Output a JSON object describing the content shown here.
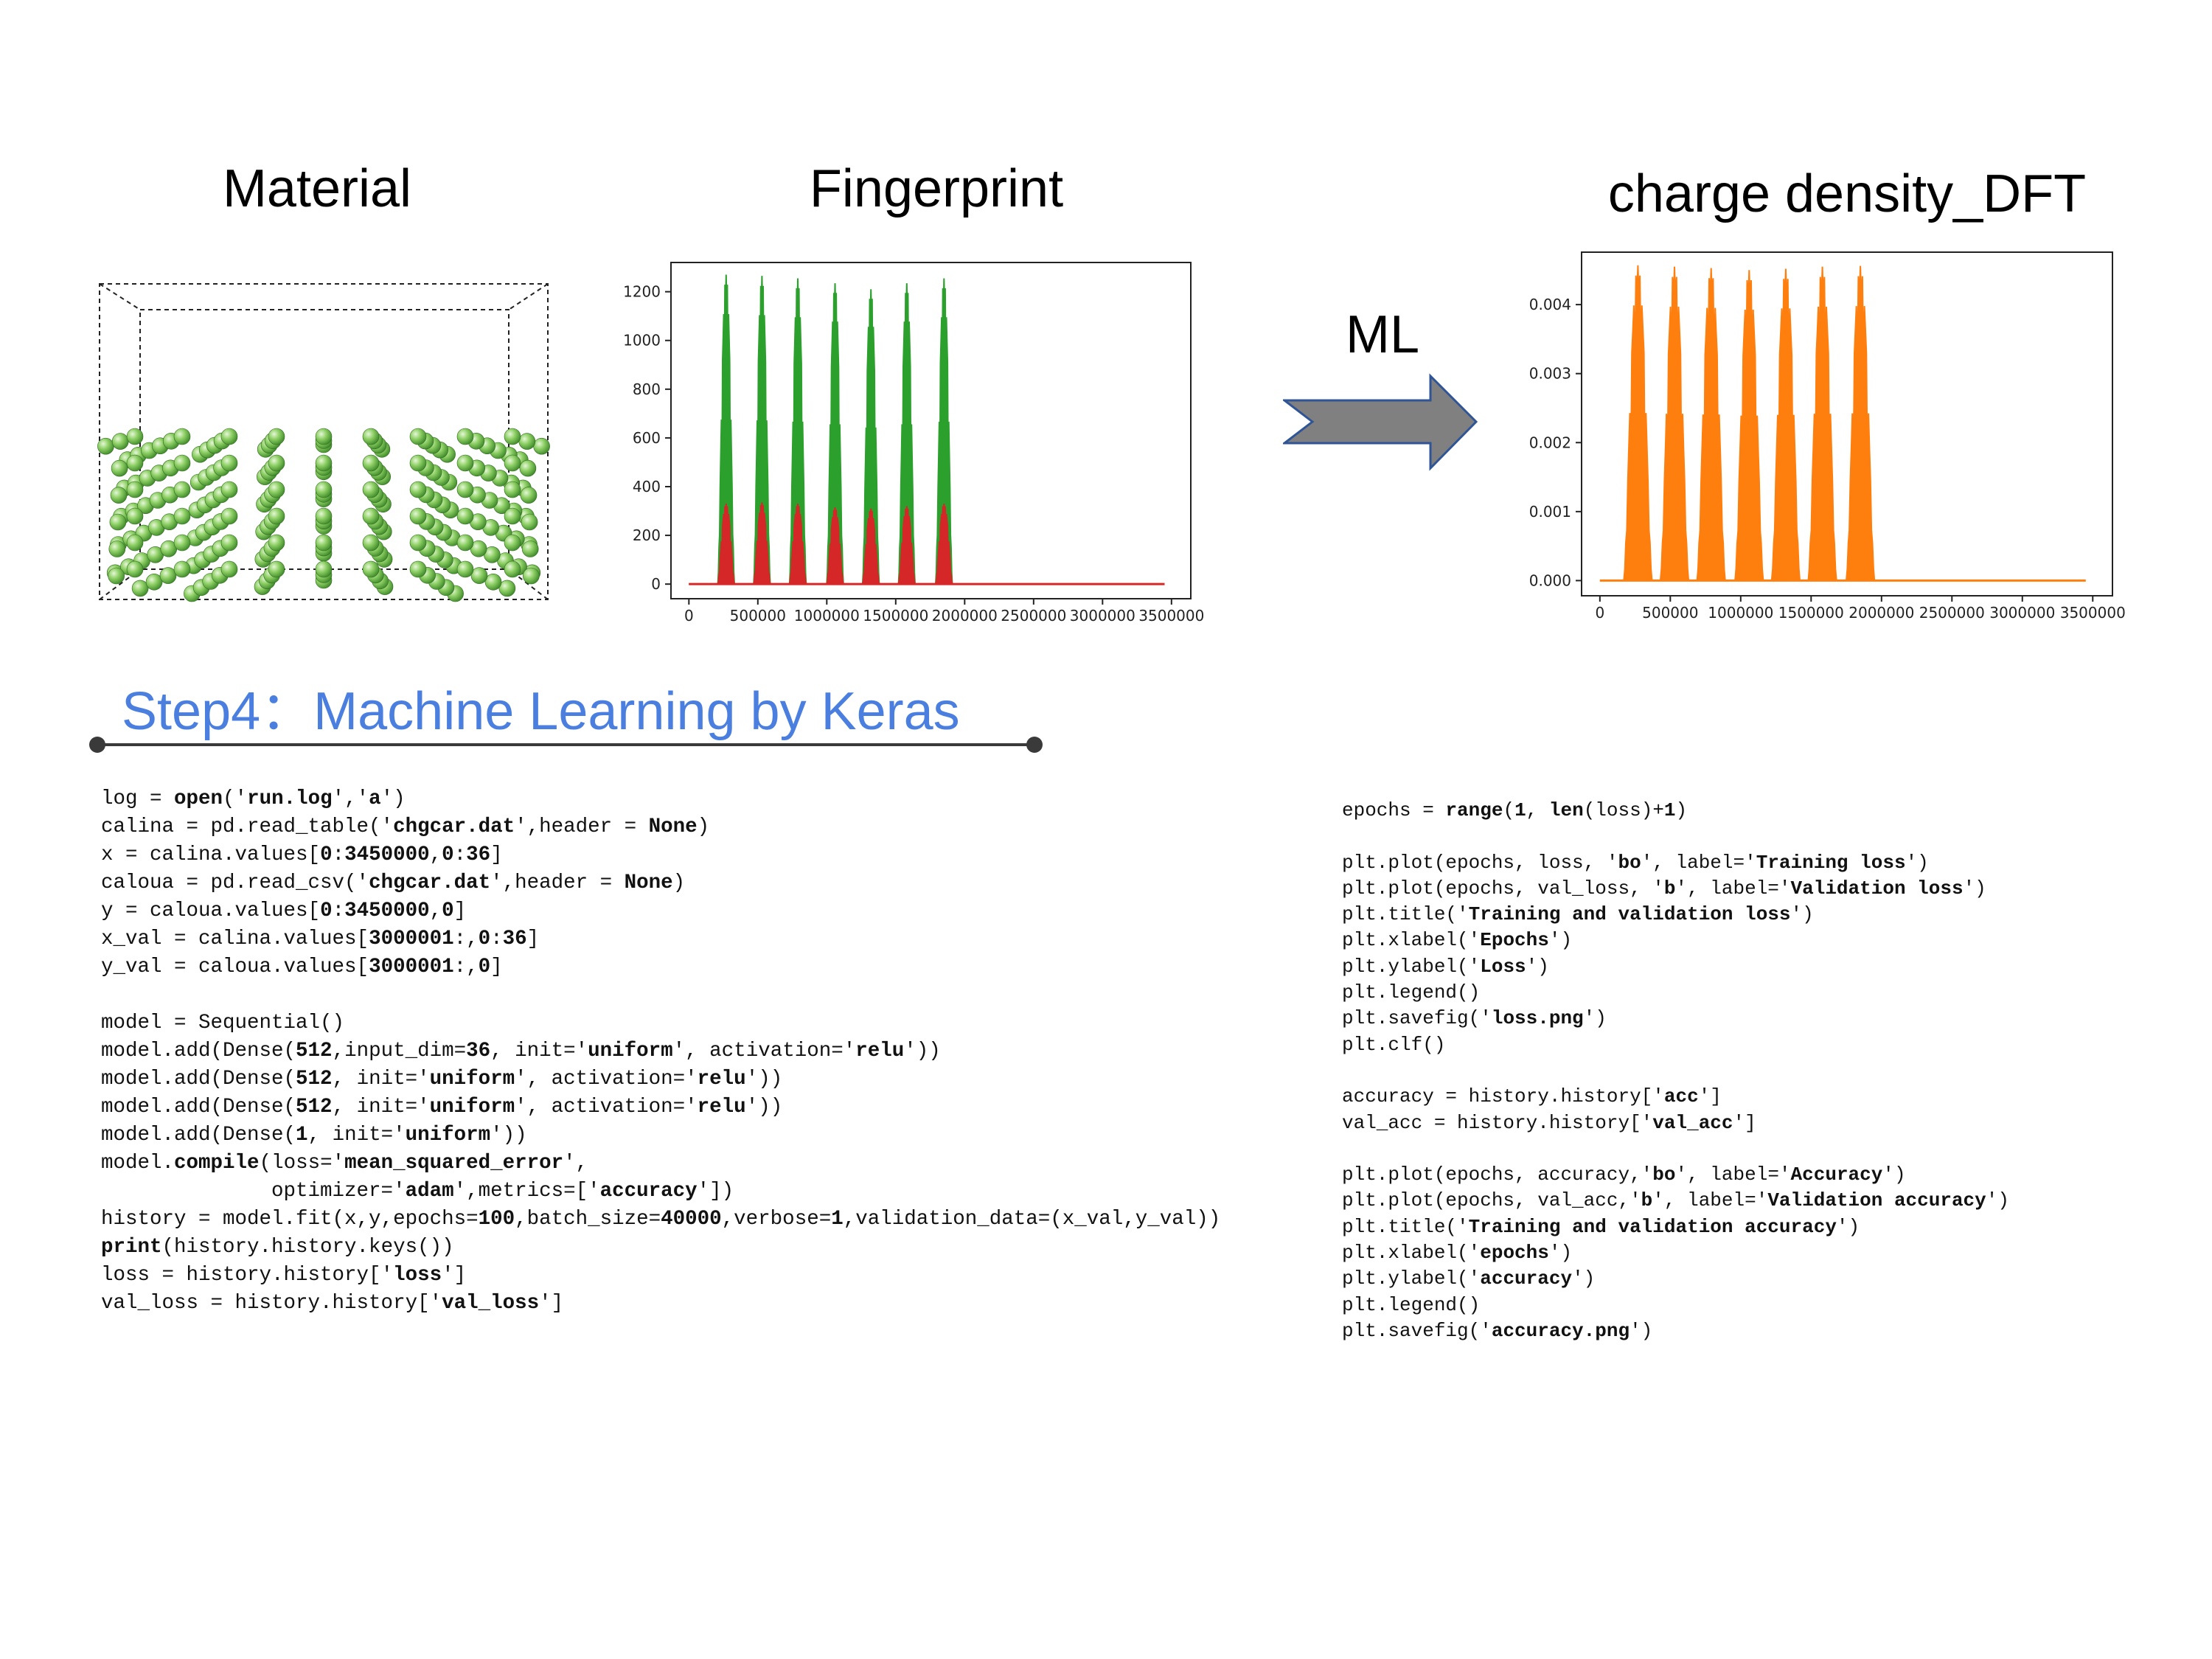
{
  "headings": {
    "material": "Material",
    "fingerprint": "Fingerprint",
    "charge": "charge density_DFT",
    "ml": "ML",
    "step": "Step4：Machine Learning by Keras"
  },
  "colors": {
    "atom": "#6fbf4e",
    "fingerprint_series_1": "#2ca02c",
    "fingerprint_series_2": "#d62728",
    "charge_series": "#ff7f0e",
    "arrow": "#808080",
    "arrow_border": "#2f5597",
    "step_title": "#4a7fe0"
  },
  "chart_data": [
    {
      "id": "fingerprint",
      "type": "area",
      "x_ticks": [
        0,
        500000,
        1000000,
        1500000,
        2000000,
        2500000,
        3000000,
        3500000
      ],
      "y_ticks": [
        0,
        200,
        400,
        600,
        800,
        1000,
        1200
      ],
      "xlim": [
        -130000,
        3640000
      ],
      "ylim": [
        -60,
        1320
      ],
      "peak_centers": [
        270000,
        530000,
        790000,
        1060000,
        1320000,
        1580000,
        1850000
      ],
      "series": [
        {
          "color": "#2ca02c",
          "peaks": [
            1270,
            1265,
            1255,
            1235,
            1210,
            1235,
            1255
          ]
        },
        {
          "color": "#d62728",
          "peaks": [
            330,
            335,
            330,
            315,
            310,
            320,
            330
          ]
        }
      ],
      "peak_halfwidth": 60000,
      "baseline_end": 3450000
    },
    {
      "id": "charge_density",
      "type": "area",
      "x_ticks": [
        0,
        500000,
        1000000,
        1500000,
        2000000,
        2500000,
        3000000,
        3500000
      ],
      "y_ticks": [
        "0.000",
        "0.001",
        "0.002",
        "0.003",
        "0.004"
      ],
      "xlim": [
        -130000,
        3640000
      ],
      "ylim": [
        -0.00022,
        0.00476
      ],
      "peak_centers": [
        270000,
        530000,
        790000,
        1060000,
        1320000,
        1580000,
        1850000
      ],
      "series": [
        {
          "color": "#ff7f0e",
          "peaks": [
            0.00457,
            0.00455,
            0.00453,
            0.0045,
            0.00452,
            0.00455,
            0.00456
          ]
        }
      ],
      "peak_halfwidth": 100000,
      "baseline_end": 3450000
    }
  ],
  "code_left": [
    [
      [
        "log = "
      ],
      [
        "open",
        "b"
      ],
      [
        "('"
      ],
      [
        "run.log",
        "b"
      ],
      [
        "','"
      ],
      [
        "a",
        "b"
      ],
      [
        "')"
      ]
    ],
    [
      [
        "calina = pd.read_table('"
      ],
      [
        "chgcar.dat",
        "b"
      ],
      [
        "',header = "
      ],
      [
        "None",
        "b"
      ],
      [
        ")"
      ]
    ],
    [
      [
        "x = calina.values["
      ],
      [
        "0",
        "b"
      ],
      [
        ":"
      ],
      [
        "3450000",
        "b"
      ],
      [
        ","
      ],
      [
        "0",
        "b"
      ],
      [
        ":"
      ],
      [
        "36",
        "b"
      ],
      [
        "]"
      ]
    ],
    [
      [
        "caloua = pd.read_csv('"
      ],
      [
        "chgcar.dat",
        "b"
      ],
      [
        "',header = "
      ],
      [
        "None",
        "b"
      ],
      [
        ")"
      ]
    ],
    [
      [
        "y = caloua.values["
      ],
      [
        "0",
        "b"
      ],
      [
        ":"
      ],
      [
        "3450000",
        "b"
      ],
      [
        ","
      ],
      [
        "0",
        "b"
      ],
      [
        "]"
      ]
    ],
    [
      [
        "x_val = calina.values["
      ],
      [
        "3000001",
        "b"
      ],
      [
        ":,"
      ],
      [
        "0",
        "b"
      ],
      [
        ":"
      ],
      [
        "36",
        "b"
      ],
      [
        "]"
      ]
    ],
    [
      [
        "y_val = caloua.values["
      ],
      [
        "3000001",
        "b"
      ],
      [
        ":,"
      ],
      [
        "0",
        "b"
      ],
      [
        "]"
      ]
    ],
    [
      [
        ""
      ]
    ],
    [
      [
        "model = Sequential()"
      ]
    ],
    [
      [
        "model.add(Dense("
      ],
      [
        "512",
        "b"
      ],
      [
        ",input_dim="
      ],
      [
        "36",
        "b"
      ],
      [
        ", init='"
      ],
      [
        "uniform",
        "b"
      ],
      [
        "', activation='"
      ],
      [
        "relu",
        "b"
      ],
      [
        "'))"
      ]
    ],
    [
      [
        "model.add(Dense("
      ],
      [
        "512",
        "b"
      ],
      [
        ", init='"
      ],
      [
        "uniform",
        "b"
      ],
      [
        "', activation='"
      ],
      [
        "relu",
        "b"
      ],
      [
        "'))"
      ]
    ],
    [
      [
        "model.add(Dense("
      ],
      [
        "512",
        "b"
      ],
      [
        ", init='"
      ],
      [
        "uniform",
        "b"
      ],
      [
        "', activation='"
      ],
      [
        "relu",
        "b"
      ],
      [
        "'))"
      ]
    ],
    [
      [
        "model.add(Dense("
      ],
      [
        "1",
        "b"
      ],
      [
        ", init='"
      ],
      [
        "uniform",
        "b"
      ],
      [
        "'))"
      ]
    ],
    [
      [
        "model."
      ],
      [
        "compile",
        "b"
      ],
      [
        "(loss='"
      ],
      [
        "mean_squared_error",
        "b"
      ],
      [
        "',"
      ]
    ],
    [
      [
        "              optimizer='"
      ],
      [
        "adam",
        "b"
      ],
      [
        "',metrics=['"
      ],
      [
        "accuracy",
        "b"
      ],
      [
        "'])"
      ]
    ],
    [
      [
        "history = model.fit(x,y,epochs="
      ],
      [
        "100",
        "b"
      ],
      [
        ",batch_size="
      ],
      [
        "40000",
        "b"
      ],
      [
        ",verbose="
      ],
      [
        "1",
        "b"
      ],
      [
        ",validation_data=(x_val,y_val))"
      ]
    ],
    [
      [
        "print",
        "b"
      ],
      [
        "(history.history.keys())"
      ]
    ],
    [
      [
        "loss = history.history['"
      ],
      [
        "loss",
        "b"
      ],
      [
        "']"
      ]
    ],
    [
      [
        "val_loss = history.history['"
      ],
      [
        "val_loss",
        "b"
      ],
      [
        "']"
      ]
    ]
  ],
  "code_right": [
    [
      [
        "epochs = "
      ],
      [
        "range",
        "b"
      ],
      [
        "("
      ],
      [
        "1",
        "b"
      ],
      [
        ", "
      ],
      [
        "len",
        "b"
      ],
      [
        "(loss)+"
      ],
      [
        "1",
        "b"
      ],
      [
        ")"
      ]
    ],
    [
      [
        ""
      ]
    ],
    [
      [
        "plt.plot(epochs, loss, '"
      ],
      [
        "bo",
        "b"
      ],
      [
        "', label='"
      ],
      [
        "Training loss",
        "b"
      ],
      [
        "')"
      ]
    ],
    [
      [
        "plt.plot(epochs, val_loss, '"
      ],
      [
        "b",
        "b"
      ],
      [
        "', label='"
      ],
      [
        "Validation loss",
        "b"
      ],
      [
        "')"
      ]
    ],
    [
      [
        "plt.title('"
      ],
      [
        "Training and validation loss",
        "b"
      ],
      [
        "')"
      ]
    ],
    [
      [
        "plt.xlabel('"
      ],
      [
        "Epochs",
        "b"
      ],
      [
        "')"
      ]
    ],
    [
      [
        "plt.ylabel('"
      ],
      [
        "Loss",
        "b"
      ],
      [
        "')"
      ]
    ],
    [
      [
        "plt.legend()"
      ]
    ],
    [
      [
        "plt.savefig('"
      ],
      [
        "loss.png",
        "b"
      ],
      [
        "')"
      ]
    ],
    [
      [
        "plt.clf()"
      ]
    ],
    [
      [
        ""
      ]
    ],
    [
      [
        "accuracy = history.history['"
      ],
      [
        "acc",
        "b"
      ],
      [
        "']"
      ]
    ],
    [
      [
        "val_acc = history.history['"
      ],
      [
        "val_acc",
        "b"
      ],
      [
        "']"
      ]
    ],
    [
      [
        ""
      ]
    ],
    [
      [
        "plt.plot(epochs, accuracy,'"
      ],
      [
        "bo",
        "b"
      ],
      [
        "', label='"
      ],
      [
        "Accuracy",
        "b"
      ],
      [
        "')"
      ]
    ],
    [
      [
        "plt.plot(epochs, val_acc,'"
      ],
      [
        "b",
        "b"
      ],
      [
        "', label='"
      ],
      [
        "Validation accuracy",
        "b"
      ],
      [
        "')"
      ]
    ],
    [
      [
        "plt.title('"
      ],
      [
        "Training and validation accuracy",
        "b"
      ],
      [
        "')"
      ]
    ],
    [
      [
        "plt.xlabel('"
      ],
      [
        "epochs",
        "b"
      ],
      [
        "')"
      ]
    ],
    [
      [
        "plt.ylabel('"
      ],
      [
        "accuracy",
        "b"
      ],
      [
        "')"
      ]
    ],
    [
      [
        "plt.legend()"
      ]
    ],
    [
      [
        "plt.savefig('"
      ],
      [
        "accuracy.png",
        "b"
      ],
      [
        "')"
      ]
    ]
  ]
}
